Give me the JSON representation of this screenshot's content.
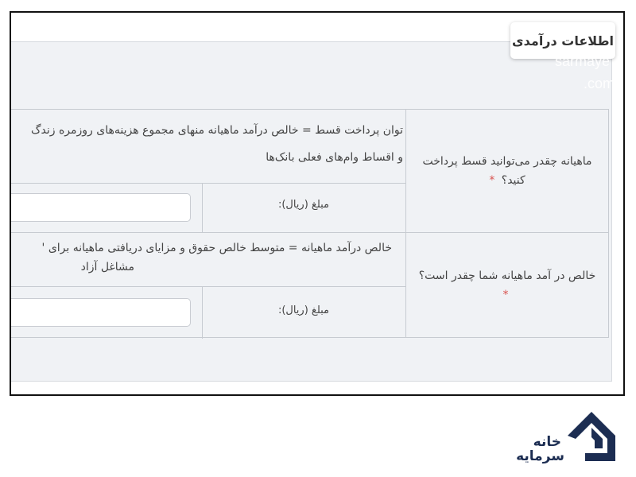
{
  "form": {
    "title": "اطلاعات درآمدی",
    "rows": [
      {
        "question": "ماهیانه چقدر می‌توانید قسط پرداخت کنید؟",
        "required_mark": "*",
        "description_line1": "توان پرداخت قسط = خالص درآمد ماهیانه منهای مجموع هزینه‌های روزمره زندگ",
        "description_line2": "و اقساط وام‌های فعلی بانک‌ها",
        "amount_label": "مبلغ (ریال):",
        "amount_value": ""
      },
      {
        "question": "خالص در آمد ماهیانه شما چقدر است؟",
        "required_mark": "*",
        "description_line1": "خالص درآمد ماهیانه = متوسط خالص حقوق و مزایای دریافتی ماهیانه برای '",
        "description_line2": "مشاغل آزاد",
        "amount_label": "مبلغ (ریال):",
        "amount_value": ""
      }
    ]
  },
  "watermark": {
    "line1": "sarmaye",
    "line2": ".com"
  },
  "logo": {
    "line1": "خانه",
    "line2": "سرمایه",
    "brand_color": "#1c2d52"
  },
  "colors": {
    "required": "#d9534f",
    "panel_bg": "#f0f2f5",
    "border": "#c7cbd1"
  }
}
